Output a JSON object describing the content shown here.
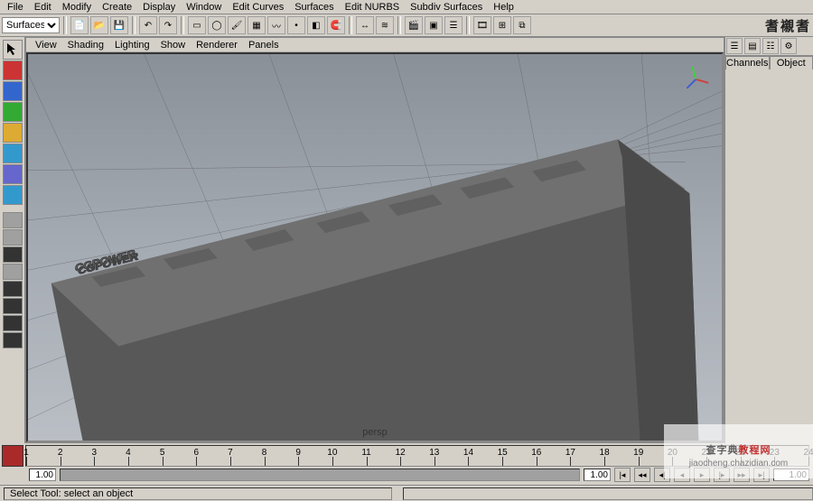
{
  "menus": [
    "File",
    "Edit",
    "Modify",
    "Create",
    "Display",
    "Window",
    "Edit Curves",
    "Surfaces",
    "Edit NURBS",
    "Subdiv Surfaces",
    "Help"
  ],
  "module_selector": "Surfaces",
  "panel_menus": [
    "View",
    "Shading",
    "Lighting",
    "Show",
    "Renderer",
    "Panels"
  ],
  "camera_label": "persp",
  "right_tabs": {
    "a": "Channels",
    "b": "Object"
  },
  "timeline": {
    "start": 1,
    "end": 24,
    "current": 1.0,
    "range_start": "1.00",
    "range_end": "1.00",
    "major_ticks": [
      1,
      2,
      3,
      4,
      5,
      6,
      7,
      8,
      9,
      10,
      11,
      12,
      13,
      14,
      15,
      16,
      17,
      18,
      19,
      20,
      21,
      22,
      23,
      24
    ]
  },
  "status": {
    "hint": "Select Tool: select an object"
  },
  "text_3d": "CGPOWER",
  "watermark": {
    "line1_a": "查字典",
    "line1_b": "教程网",
    "line2": "jiaocheng.chazidian.com"
  },
  "cjk_toolbar": "耆襯耆",
  "toolbar_icons": [
    "file-new",
    "file-open",
    "file-save",
    "sep",
    "undo",
    "redo",
    "sep",
    "select",
    "lasso",
    "paint-select",
    "move",
    "rotate",
    "scale",
    "sep",
    "snap-grid",
    "snap-curve",
    "snap-point",
    "snap-plane",
    "sep",
    "history",
    "construction",
    "sep",
    "render",
    "ipr",
    "render-settings",
    "sep",
    "playblast",
    "hypershade",
    "outliner"
  ],
  "toolbox": [
    {
      "name": "select-tool",
      "style": ""
    },
    {
      "name": "lasso-tool",
      "style": "red"
    },
    {
      "name": "move-tool",
      "style": "blue"
    },
    {
      "name": "rotate-tool",
      "style": "green"
    },
    {
      "name": "scale-tool",
      "style": "yell"
    },
    {
      "name": "soft-mod",
      "style": "cyan"
    },
    {
      "name": "show-manip",
      "style": "purp"
    },
    {
      "name": "last-tool",
      "style": "cyan"
    }
  ],
  "layout_presets": [
    "single",
    "four",
    "two-h",
    "two-v",
    "three-a",
    "three-b",
    "outliner-persp",
    "hyper-persp"
  ],
  "right_icons": [
    "channel-box",
    "layer-editor",
    "attribute-editor",
    "tool-settings"
  ],
  "playback": [
    "go-start",
    "step-back",
    "prev-key",
    "play-back",
    "play-fwd",
    "next-key",
    "step-fwd",
    "go-end"
  ]
}
